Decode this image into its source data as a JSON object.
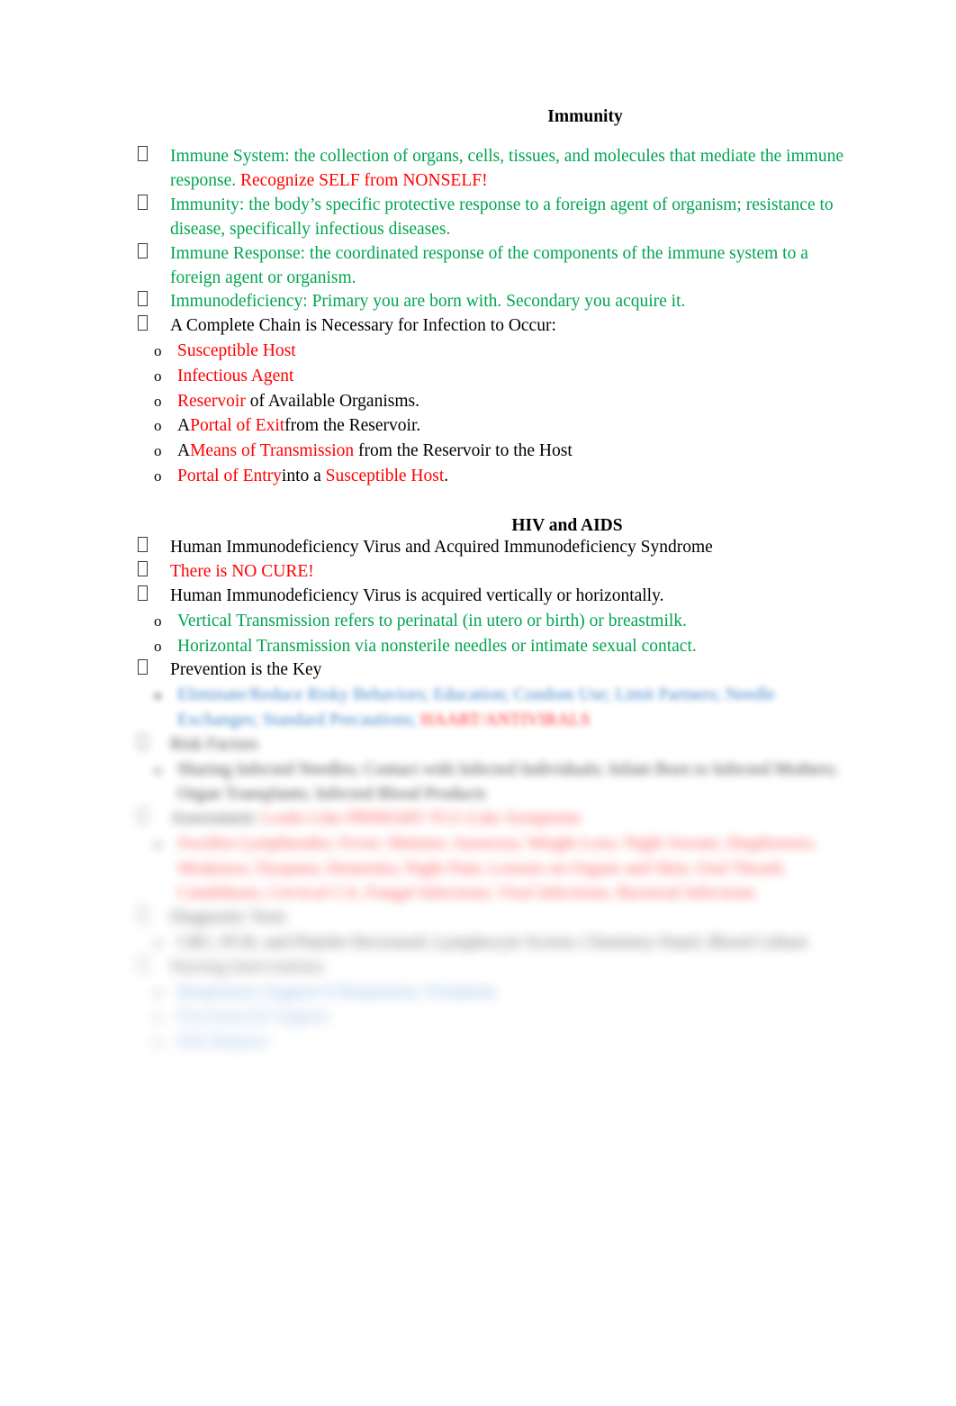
{
  "document": {
    "section1": {
      "title": "Immunity",
      "bullets": [
        {
          "runs": [
            {
              "text": "Immune System: the collection of organs, cells, tissues, and molecules that mediate the immune response.  ",
              "color": "green"
            },
            {
              "text": "Recognize SELF from NONSELF!",
              "color": "red"
            }
          ]
        },
        {
          "runs": [
            {
              "text": "Immunity: the body’s specific protective response to a foreign agent of organism; resistance to disease, specifically infectious diseases.",
              "color": "green"
            }
          ]
        },
        {
          "runs": [
            {
              "text": "Immune Response: the coordinated response of the components of the immune system to a foreign agent or organism.",
              "color": "green"
            }
          ]
        },
        {
          "runs": [
            {
              "text": "Immunodeficiency: Primary you are born with. Secondary you acquire it.",
              "color": "green"
            }
          ]
        },
        {
          "runs": [
            {
              "text": "A Complete Chain is Necessary for Infection to Occur:",
              "color": "black"
            }
          ],
          "sub": [
            {
              "runs": [
                {
                  "text": "Susceptible Host",
                  "color": "red"
                }
              ]
            },
            {
              "runs": [
                {
                  "text": "Infectious Agent",
                  "color": "red"
                }
              ]
            },
            {
              "runs": [
                {
                  "text": "Reservoir",
                  "color": "red"
                },
                {
                  "text": " of Available Organisms.",
                  "color": "black"
                }
              ]
            },
            {
              "runs": [
                {
                  "text": "A",
                  "color": "black"
                },
                {
                  "text": "Portal of Exit",
                  "color": "red"
                },
                {
                  "text": "from the Reservoir.",
                  "color": "black"
                }
              ]
            },
            {
              "runs": [
                {
                  "text": "A",
                  "color": "black"
                },
                {
                  "text": "Means of Transmission",
                  "color": "red"
                },
                {
                  "text": " from the Reservoir to the Host",
                  "color": "black"
                }
              ]
            },
            {
              "runs": [
                {
                  "text": "Portal of Entry",
                  "color": "red"
                },
                {
                  "text": "into a ",
                  "color": "black"
                },
                {
                  "text": "Susceptible Host",
                  "color": "red"
                },
                {
                  "text": ".",
                  "color": "black"
                }
              ]
            }
          ]
        }
      ]
    },
    "section2": {
      "title": "HIV and AIDS",
      "bullets": [
        {
          "runs": [
            {
              "text": "Human Immunodeficiency Virus and Acquired Immunodeficiency Syndrome",
              "color": "black"
            }
          ]
        },
        {
          "runs": [
            {
              "text": "There is NO CURE!",
              "color": "red"
            }
          ]
        },
        {
          "runs": [
            {
              "text": "Human Immunodeficiency Virus is acquired vertically or horizontally.",
              "color": "black"
            }
          ],
          "sub": [
            {
              "runs": [
                {
                  "text": "Vertical Transmission refers to perinatal (in utero or birth) or breastmilk.",
                  "color": "green"
                }
              ]
            },
            {
              "runs": [
                {
                  "text": "Horizontal Transmission via nonsterile needles or intimate sexual contact.",
                  "color": "green"
                }
              ]
            }
          ]
        },
        {
          "runs": [
            {
              "text": "Prevention is the Key",
              "color": "black"
            }
          ],
          "sub": [
            {
              "blur": "b1",
              "runs": [
                {
                  "text": "Eliminate/Reduce Risky Behaviors; Education; Condom Use; Limit Partners; Needle Exchanges; Standard Precautions; ",
                  "color": "blue"
                },
                {
                  "text": "HAART/ANTIVIRALS",
                  "color": "red"
                }
              ]
            }
          ]
        },
        {
          "blur": "b2",
          "runs": [
            {
              "text": "Risk Factors",
              "color": "black"
            }
          ],
          "sub": [
            {
              "blur": "b2",
              "runs": [
                {
                  "text": "Sharing Infected Needles; Contact with Infected Individuals; Infant Born to Infected Mothers; Organ Transplants; Infected Blood Products",
                  "color": "black"
                }
              ]
            }
          ]
        },
        {
          "blur": "b3",
          "runs": [
            {
              "text": "Assessment:",
              "color": "black"
            },
            {
              "text": "  Looks Like PRIMARY FLU-Like Symptoms",
              "color": "red"
            }
          ],
          "sub": [
            {
              "blur": "b3",
              "runs": [
                {
                  "text": "Swollen Lymphnodes; Fever; Malaise; Anorexia; Weight Loss; Night Sweats; Diaphoresis; Weakness; Dyspnea; Dementia; Night Pain; Lesions on Organs and Skin; Oral Thrush; Candidiasis; Cervical CA; Fungal Infections; Viral Infections; Bacterial Infections",
                  "color": "red"
                }
              ]
            }
          ]
        },
        {
          "blur": "b4",
          "runs": [
            {
              "text": "Diagnostic Tests",
              "color": "black"
            }
          ],
          "sub": [
            {
              "blur": "b4",
              "runs": [
                {
                  "text": "CBC; PCR; and Platelet Decreased; Lymphocyte Screen; Chemistry Panel; Blood Culture",
                  "color": "black"
                }
              ]
            }
          ]
        },
        {
          "blur": "b5",
          "runs": [
            {
              "text": "Nursing Interventions",
              "color": "black"
            }
          ],
          "sub": [
            {
              "blur": "b5",
              "runs": [
                {
                  "text": "Respiratory Support if Respiratory Treatment",
                  "color": "blue"
                }
              ]
            },
            {
              "blur": "b6",
              "runs": [
                {
                  "text": "Psychosocial Support",
                  "color": "blue"
                }
              ]
            },
            {
              "blur": "b6",
              "runs": [
                {
                  "text": "Diet Balance",
                  "color": "blue"
                }
              ]
            }
          ]
        }
      ]
    }
  }
}
